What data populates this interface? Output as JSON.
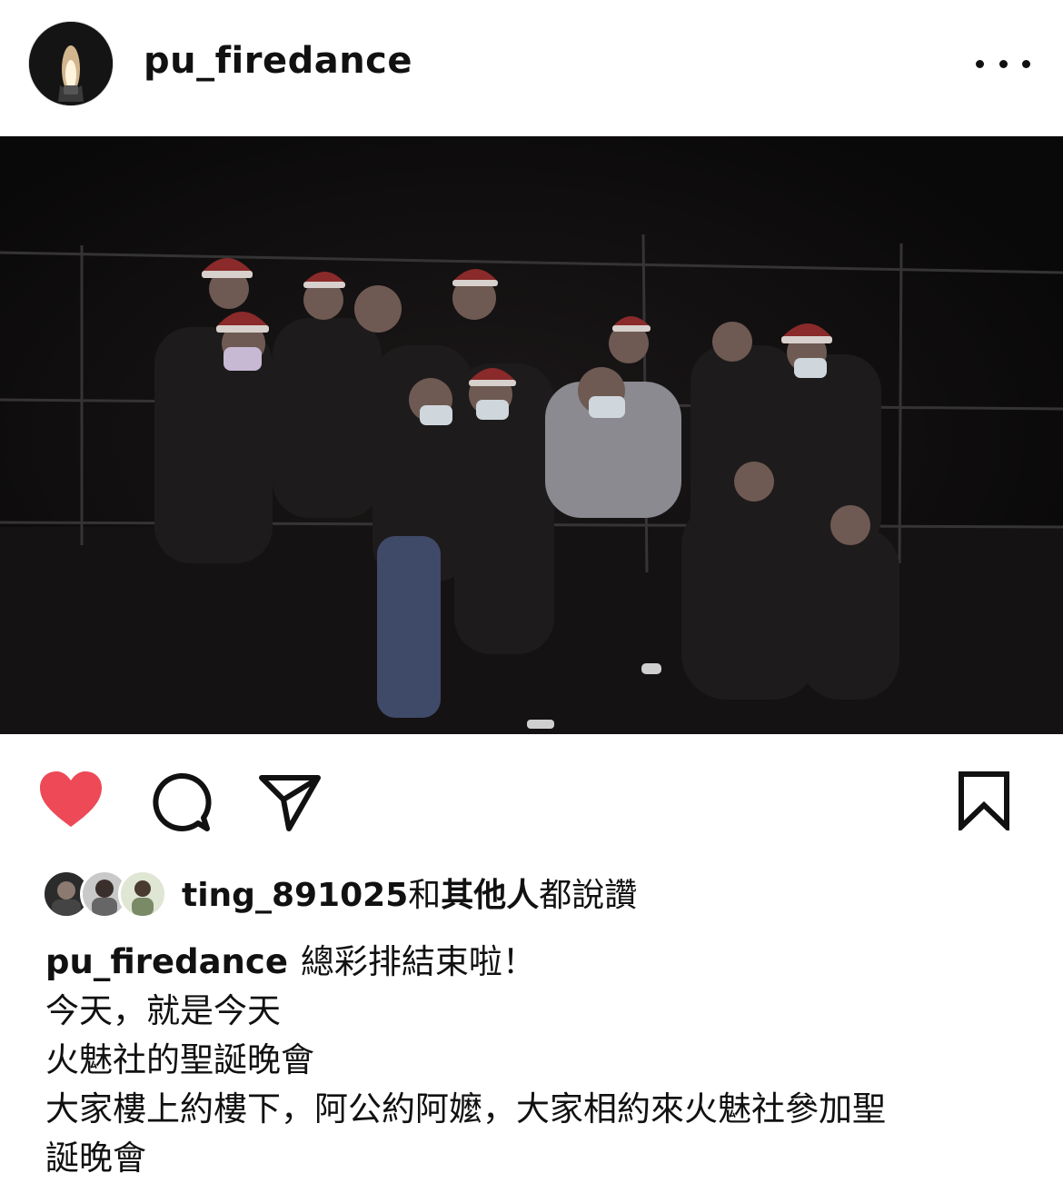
{
  "post": {
    "username": "pu_firedance"
  },
  "actions": {
    "liked": true,
    "like_color": "#ed4956"
  },
  "likes": {
    "user": "ting_891025",
    "connector": "和",
    "others": "其他人",
    "suffix": "都說讚"
  },
  "caption": {
    "username": "pu_firedance",
    "first_line": "總彩排結束啦！",
    "lines": [
      "今天，就是今天",
      "火魅社的聖誕晚會",
      "大家樓上約樓下，阿公約阿嬤，大家相約來火魅社參加聖",
      "誕晚會"
    ]
  },
  "icons": {
    "more": "more-horizontal-icon",
    "like": "heart-icon",
    "comment": "comment-bubble-icon",
    "share": "paper-plane-icon",
    "save": "bookmark-icon"
  }
}
